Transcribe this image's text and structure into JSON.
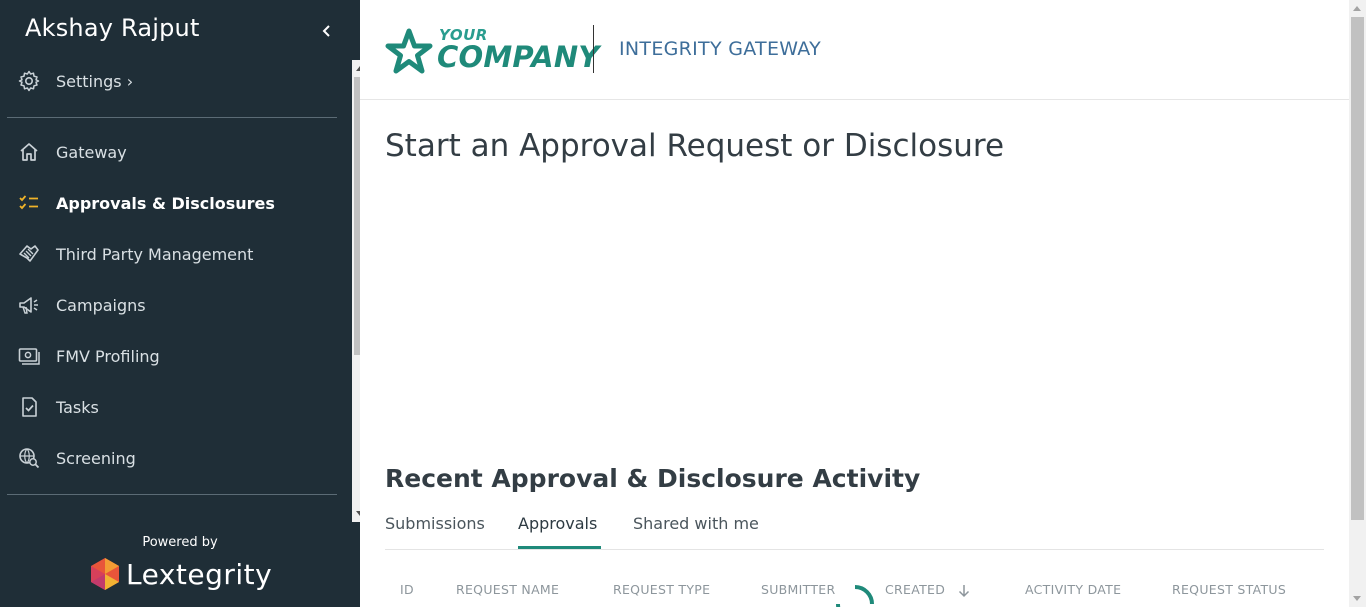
{
  "sidebar": {
    "user_name": "Akshay Rajput",
    "settings_label": "Settings ›",
    "items": [
      {
        "label": "Gateway",
        "icon": "home-icon"
      },
      {
        "label": "Approvals & Disclosures",
        "icon": "checklist-icon",
        "active": true
      },
      {
        "label": "Third Party Management",
        "icon": "handshake-icon"
      },
      {
        "label": "Campaigns",
        "icon": "megaphone-icon"
      },
      {
        "label": "FMV Profiling",
        "icon": "money-icon"
      },
      {
        "label": "Tasks",
        "icon": "task-icon"
      },
      {
        "label": "Screening",
        "icon": "search-globe-icon"
      }
    ],
    "powered_by": "Powered by",
    "brand": "Lextegrity"
  },
  "header": {
    "logo_your": "YOUR",
    "logo_company": "COMPANY",
    "title": "INTEGRITY GATEWAY"
  },
  "main": {
    "page_title": "Start an Approval Request or Disclosure",
    "recent_title": "Recent Approval & Disclosure Activity",
    "tabs": [
      {
        "label": "Submissions"
      },
      {
        "label": "Approvals",
        "active": true
      },
      {
        "label": "Shared with me"
      }
    ],
    "columns": [
      "ID",
      "REQUEST NAME",
      "REQUEST TYPE",
      "SUBMITTER",
      "CREATED",
      "ACTIVITY DATE",
      "REQUEST STATUS"
    ]
  },
  "colors": {
    "sidebar_bg": "#1f2e37",
    "accent": "#1f8a7a",
    "active_icon": "#f0b429",
    "title_blue": "#3e6e9a"
  }
}
